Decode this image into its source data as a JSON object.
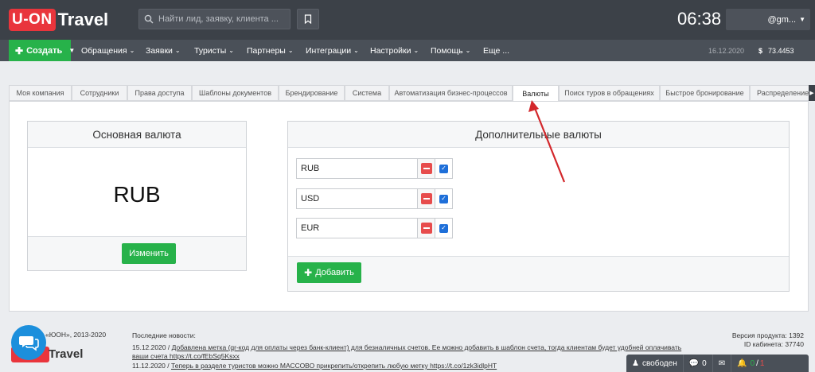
{
  "header": {
    "logo_box": "U-ON",
    "logo_text": "Travel",
    "search_placeholder": "Найти лид, заявку, клиента ...",
    "time": "06:38",
    "user_email": "@gm..."
  },
  "nav": {
    "create": "Создать",
    "items": [
      "Обращения",
      "Заявки",
      "Туристы",
      "Партнеры",
      "Интеграции",
      "Настройки",
      "Помощь",
      "Еще ..."
    ],
    "date": "16.12.2020",
    "currency_symbol": "$",
    "rate": "73.4453"
  },
  "tabs": [
    {
      "label": "Моя компания"
    },
    {
      "label": "Сотрудники"
    },
    {
      "label": "Права доступа"
    },
    {
      "label": "Шаблоны документов"
    },
    {
      "label": "Брендирование"
    },
    {
      "label": "Система"
    },
    {
      "label": "Автоматизация бизнес-процессов"
    },
    {
      "label": "Валюты",
      "active": true
    },
    {
      "label": "Поиск туров в обращениях"
    },
    {
      "label": "Быстрое бронирование"
    },
    {
      "label": "Распределение"
    }
  ],
  "main_currency": {
    "title": "Основная валюта",
    "value": "RUB",
    "change_button": "Изменить"
  },
  "extra_currencies": {
    "title": "Дополнительные валюты",
    "items": [
      {
        "code": "RUB",
        "checked": true
      },
      {
        "code": "USD",
        "checked": true
      },
      {
        "code": "EUR",
        "checked": true
      }
    ],
    "add_button": "Добавить"
  },
  "footer": {
    "copyright": "ООО \"ЮОН\", 2013-2020",
    "copyright_visible": "«ЮОН», 2013-2020",
    "news_title": "Последние новости:",
    "news": [
      {
        "date": "15.12.2020 /",
        "text": "Добавлена метка (qr-код для оплаты через банк-клиент) для безналичных счетов. Ее можно добавить в шаблон счета, тогда клиентам будет удобней оплачивать"
      },
      {
        "date": "",
        "text": "ваши счета https://t.co/fEbSq5Ksxx"
      },
      {
        "date": "11.12.2020 /",
        "text": "Теперь в разделе туристов можно МАССОВО прикрепить/открепить любую метку https://t.co/1zk3idlpHT"
      }
    ],
    "version_label": "Версия продукта: 1392",
    "cabinet_label": "ID кабинета: 37740",
    "brand_text": "Travel"
  },
  "status_bar": {
    "state": "свободен",
    "messages": "0",
    "mail": "",
    "notif_green": "0",
    "notif_sep": "/",
    "notif_red": "1"
  },
  "colors": {
    "accent_green": "#27b24a",
    "brand_red": "#e9353c",
    "dark_bar": "#3c4148",
    "annotation_arrow": "#d3272b"
  }
}
